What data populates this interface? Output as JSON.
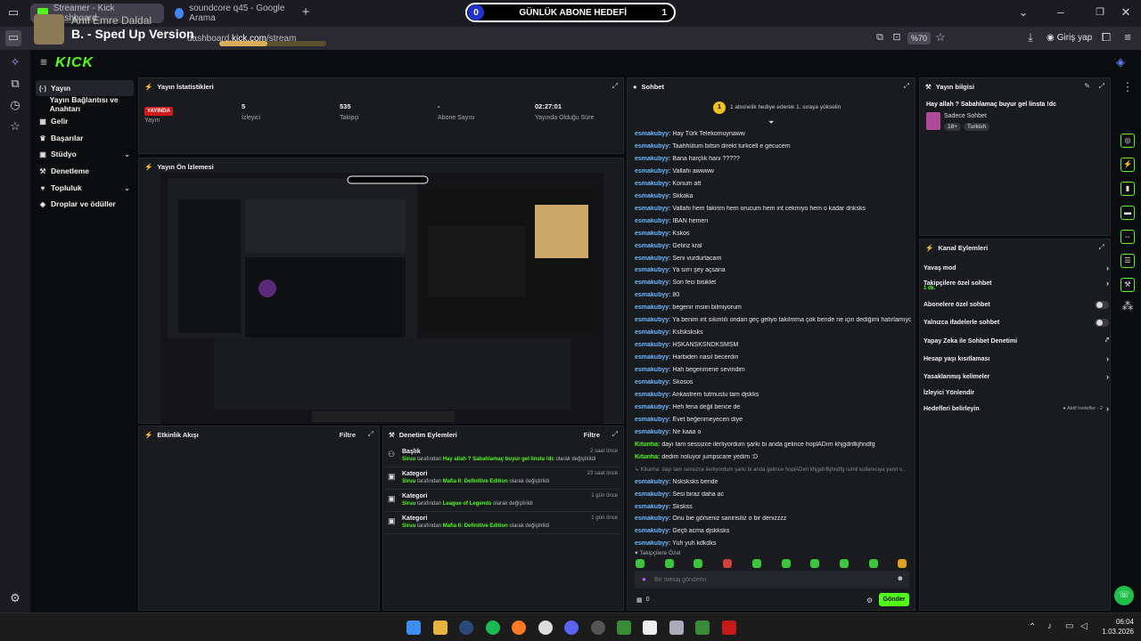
{
  "browser": {
    "tabs": [
      {
        "label": "Streamer - Kick Dashboard"
      },
      {
        "label": "soundcore q45 - Google Arama"
      }
    ],
    "new_tab": "+",
    "url_prefix": "dashboard.",
    "url_domain": "kick.com",
    "url_suffix": "/stream",
    "zoom": "%70",
    "signin": "Giriş yap"
  },
  "goal": {
    "current": "0",
    "label": "GÜNLÜK ABONE HEDEFİ",
    "target": "1"
  },
  "music": {
    "artist": "Anıl Emre Daldal",
    "song": "B. - Sped Up Version",
    "progress": 0.45
  },
  "kick": {
    "logo": "KICK"
  },
  "sidebar": {
    "items": [
      {
        "label": "Yayın",
        "icon": "(·)"
      },
      {
        "label": "Yayın Bağlantısı ve Anahtarı",
        "icon": ""
      },
      {
        "label": "Gelir",
        "icon": "▦"
      },
      {
        "label": "Başarılar",
        "icon": "♛"
      },
      {
        "label": "Stüdyo",
        "icon": "▣",
        "chevron": "⌄"
      },
      {
        "label": "Denetleme",
        "icon": "⚒"
      },
      {
        "label": "Topluluk",
        "icon": "♥",
        "chevron": "⌄"
      },
      {
        "label": "Droplar ve ödüller",
        "icon": "◆"
      }
    ]
  },
  "stats": {
    "title": "Yayın İstatistikleri",
    "live": "YAYINDA",
    "live_label": "Yayın",
    "viewers": "5",
    "viewers_label": "İzleyici",
    "followers": "535",
    "followers_label": "Takipçi",
    "subs": "-",
    "subs_label": "Abone Sayısı",
    "uptime": "02:27:01",
    "uptime_label": "Yayında Olduğu Süre"
  },
  "preview": {
    "title": "Yayın Ön İzlemesi"
  },
  "activity": {
    "title": "Etkinlik Akışı",
    "filter": "Filtre"
  },
  "modlog": {
    "title": "Denetim Eylemleri",
    "filter": "Filtre",
    "entries": [
      {
        "type": "Başlık",
        "by": "Siruu",
        "mid": "tarafından",
        "value": "Hay allah ? Sabahlamaç buyur gel linsta !dc",
        "end": "olarak değiştirildi",
        "time": "2 saat önce"
      },
      {
        "type": "Kategori",
        "by": "Siruu",
        "mid": "tarafından",
        "value": "Mafia II: Definitive Edition",
        "end": "olarak değiştirildi",
        "time": "23 saat önce"
      },
      {
        "type": "Kategori",
        "by": "Siruu",
        "mid": "tarafından",
        "value": "League of Legends",
        "end": "olarak değiştirildi",
        "time": "1 gün önce"
      },
      {
        "type": "Kategori",
        "by": "Siruu",
        "mid": "tarafından",
        "value": "Mafia II: Definitive Edition",
        "end": "olarak değiştirildi",
        "time": "1 gün önce"
      }
    ]
  },
  "chat": {
    "title": "Sohbet",
    "pinned": "1 abonelik hediye ederek 1. sıraya yükselin",
    "messages": [
      {
        "user": "esmakubyy:",
        "text": "Hay Türk Telekomuynaww"
      },
      {
        "user": "esmakubyy:",
        "text": "Taahhütum bitsin direkt turkcell e gecucem"
      },
      {
        "user": "esmakubyy:",
        "text": "Bana harçlık hani ?????"
      },
      {
        "user": "esmakubyy:",
        "text": "Vallahi awwww"
      },
      {
        "user": "esmakubyy:",
        "text": "Konum att"
      },
      {
        "user": "esmakubyy:",
        "text": "Skkaka"
      },
      {
        "user": "esmakubyy:",
        "text": "Vallahi hem fakirim hem orucum hem int cekmiyo hem o kadar dnksks"
      },
      {
        "user": "esmakubyy:",
        "text": "IBAN hemen"
      },
      {
        "user": "esmakubyy:",
        "text": "Kskos"
      },
      {
        "user": "esmakubyy:",
        "text": "Geliriz kral"
      },
      {
        "user": "esmakubyy:",
        "text": "Seni vurdurtacam"
      },
      {
        "user": "esmakubyy:",
        "text": "Ya sırrı şey açsana"
      },
      {
        "user": "esmakubyy:",
        "text": "Son feci bisiklet"
      },
      {
        "user": "esmakubyy:",
        "text": "80"
      },
      {
        "user": "esmakubyy:",
        "text": "begenir msiin bilmiyorum"
      },
      {
        "user": "esmakubyy:",
        "text": "Ya benim int sıkıntılı ondan geç geliyo takılmma çok bende ne için dediğimi hatırlamıyorum"
      },
      {
        "user": "esmakubyy:",
        "text": "Kslsksksks"
      },
      {
        "user": "esmakubyy:",
        "text": "HSKANSKSNDKSMSM"
      },
      {
        "user": "esmakubyy:",
        "text": "Harbiden nasıl becerdin"
      },
      {
        "user": "esmakubyy:",
        "text": "Hah begenmene sevindim"
      },
      {
        "user": "esmakubyy:",
        "text": "Skosos"
      },
      {
        "user": "esmakubyy:",
        "text": "Ankastrem tutmustu tam djskks"
      },
      {
        "user": "esmakubyy:",
        "text": "Heh fena değil bence de"
      },
      {
        "user": "esmakubyy:",
        "text": "Evet beğenmeyecen diye"
      },
      {
        "user": "esmakubyy:",
        "text": "Ne kaaa o"
      },
      {
        "user": "Kitunha:",
        "text": "dayı tam sessizce ilerliyordum şarkı bi anda gelince hoplADım khjgdnfkjhndfg",
        "green": true
      },
      {
        "user": "Kitunha:",
        "text": "dedim noluyor jumpscare yedim :D",
        "green": true
      },
      {
        "user": "",
        "text": "↳ Kitunha: dayı tam sessizce ilerliyordum şarkı bi anda gelince hoplADım khjgdnfkjhndfg isimli kullanıcıya yanıt v...",
        "reply": true
      },
      {
        "user": "esmakubyy:",
        "text": "Nsksksks bende"
      },
      {
        "user": "esmakubyy:",
        "text": "Sesi biraz daha ac"
      },
      {
        "user": "esmakubyy:",
        "text": "Skskss"
      },
      {
        "user": "esmakubyy:",
        "text": "Onu bie görseniz sanirisiliz o bir denizzzz"
      },
      {
        "user": "esmakubyy:",
        "text": "Geçti acma djskksks"
      },
      {
        "user": "esmakubyy:",
        "text": "Yuh yuh kdkdks"
      }
    ],
    "followers_only": "♥ Takipçilere Özel",
    "placeholder": "Bir mesaj gönderin",
    "count": "0",
    "send": "Gönder"
  },
  "stream_info": {
    "title": "Yayın bilgisi",
    "stream_title": "Hay allah ? Sabahlamaç buyur gel linsta !dc",
    "category": "Sadece Sohbet",
    "tags": [
      "18+",
      "Turkish"
    ]
  },
  "channel_actions": {
    "title": "Kanal Eylemleri",
    "rows": [
      {
        "label": "Yavaş mod",
        "kind": "arrow"
      },
      {
        "label": "Takipçilere özel sohbet",
        "sub": "1 dk.",
        "kind": "arrow"
      },
      {
        "label": "Abonelere özel sohbet",
        "kind": "toggle"
      },
      {
        "label": "Yalnızca ifadelerle sohbet",
        "kind": "toggle"
      },
      {
        "label": "Yapay Zeka ile Sohbet Denetimi",
        "kind": "ext"
      },
      {
        "label": "Hesap yaşı kısıtlaması",
        "kind": "arrow"
      },
      {
        "label": "Yasaklanmış kelimeler",
        "kind": "arrow"
      },
      {
        "label": "İzleyici Yönlendir",
        "kind": "none"
      },
      {
        "label": "Hedefleri belirleyin",
        "kind": "arrow",
        "extra": "● Aktif hedefler - 2"
      }
    ]
  },
  "clock": {
    "time": "06:04",
    "date": "1.03.2026"
  }
}
